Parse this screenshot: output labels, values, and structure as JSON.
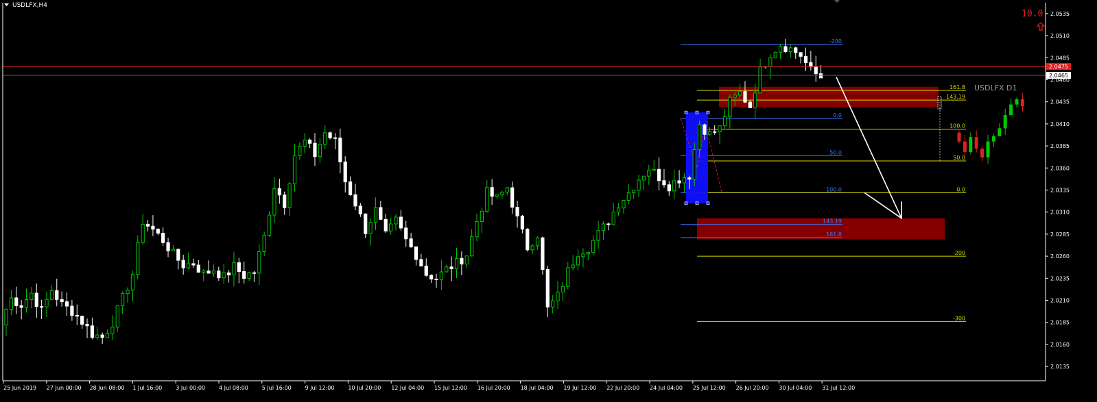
{
  "window": {
    "symbol_label": "USDLFX,H4"
  },
  "counter": {
    "value": "10.0",
    "color": "#e02020"
  },
  "inset": {
    "label": "USDLFX D1"
  },
  "colors": {
    "background": "#000000",
    "bull": "#00c800",
    "bear": "#ffffff",
    "fib_yellow": "#d8d800",
    "fib_blue": "#3c78ff",
    "zone": "#8b0000",
    "pattern": "#1010ff",
    "price_red": "#e02020",
    "price_line": "#4a6a6a",
    "arrow": "#ffffff"
  },
  "chart_data": {
    "type": "candlestick",
    "timeframe": "H4",
    "ylim": [
      2.0125,
      2.0545
    ],
    "y_ticks": [
      "2.0535",
      "2.0510",
      "2.0485",
      "2.0460",
      "2.0435",
      "2.0410",
      "2.0385",
      "2.0360",
      "2.0335",
      "2.0310",
      "2.0285",
      "2.0260",
      "2.0235",
      "2.0210",
      "2.0185",
      "2.0160",
      "2.0135"
    ],
    "x_ticks": [
      "25 Jun 2019",
      "27 Jun 00:00",
      "28 Jun 08:00",
      "1 Jul 16:00",
      "3 Jul 00:00",
      "4 Jul 08:00",
      "5 Jul 16:00",
      "9 Jul 12:00",
      "10 Jul 20:00",
      "12 Jul 04:00",
      "15 Jul 12:00",
      "16 Jul 20:00",
      "18 Jul 04:00",
      "19 Jul 12:00",
      "22 Jul 20:00",
      "24 Jul 04:00",
      "25 Jul 12:00",
      "26 Jul 20:00",
      "30 Jul 04:00",
      "31 Jul 12:00"
    ],
    "price_tags": [
      {
        "value": "2.0475",
        "kind": "ask"
      },
      {
        "value": "2.0465",
        "kind": "bid"
      }
    ],
    "close_path": [
      2.0188,
      2.0212,
      2.0205,
      2.0218,
      2.0198,
      2.0222,
      2.0205,
      2.0198,
      2.0186,
      2.0172,
      2.0168,
      2.0185,
      2.0212,
      2.024,
      2.03,
      2.029,
      2.0278,
      2.0262,
      2.025,
      2.0252,
      2.024,
      2.0245,
      2.0236,
      2.0248,
      2.0238,
      2.0242,
      2.0282,
      2.034,
      2.032,
      2.0375,
      2.039,
      2.0375,
      2.04,
      2.039,
      2.0345,
      2.032,
      2.029,
      2.0312,
      2.0283,
      2.03,
      2.0278,
      2.0262,
      2.024,
      2.0235,
      2.0245,
      2.0252,
      2.0262,
      2.03,
      2.0332,
      2.0325,
      2.0338,
      2.0302,
      2.027,
      2.0285,
      2.02,
      2.0215,
      2.0243,
      2.0265,
      2.027,
      2.0285,
      2.03,
      2.032,
      2.0332,
      2.0348,
      2.036,
      2.035,
      2.034,
      2.0348,
      2.0352,
      2.041,
      2.0398,
      2.0405,
      2.0435,
      2.0445,
      2.043,
      2.047,
      2.049,
      2.05,
      2.0495,
      2.0488,
      2.047,
      2.0463
    ],
    "fib_left": {
      "line_color": "#3c78ff",
      "levels": [
        {
          "label": "-200",
          "price": 2.05
        },
        {
          "label": "0.0",
          "price": 2.0416
        },
        {
          "label": "50.0",
          "price": 2.0374
        },
        {
          "label": "100.0",
          "price": 2.0332
        },
        {
          "label": "143.19",
          "price": 2.0296
        },
        {
          "label": "161.8",
          "price": 2.0281
        }
      ]
    },
    "fib_right": {
      "line_color": "#d8d800",
      "levels": [
        {
          "label": "161.8",
          "price": 2.0448
        },
        {
          "label": "143.19",
          "price": 2.0437
        },
        {
          "label": "100.0",
          "price": 2.0404
        },
        {
          "label": "50.0",
          "price": 2.0368
        },
        {
          "label": "0.0",
          "price": 2.0332
        },
        {
          "label": "-200",
          "price": 2.026
        },
        {
          "label": "-300",
          "price": 2.0186
        }
      ]
    },
    "zones": [
      {
        "name": "upper-target-zone",
        "from": 2.0429,
        "to": 2.0452
      },
      {
        "name": "lower-target-zone",
        "from": 2.0279,
        "to": 2.0303
      }
    ],
    "inset_closes": [
      2.039,
      2.0378,
      2.0395,
      2.0382,
      2.0372,
      2.039,
      2.0396,
      2.0405,
      2.042,
      2.0432,
      2.0438,
      2.043
    ]
  }
}
